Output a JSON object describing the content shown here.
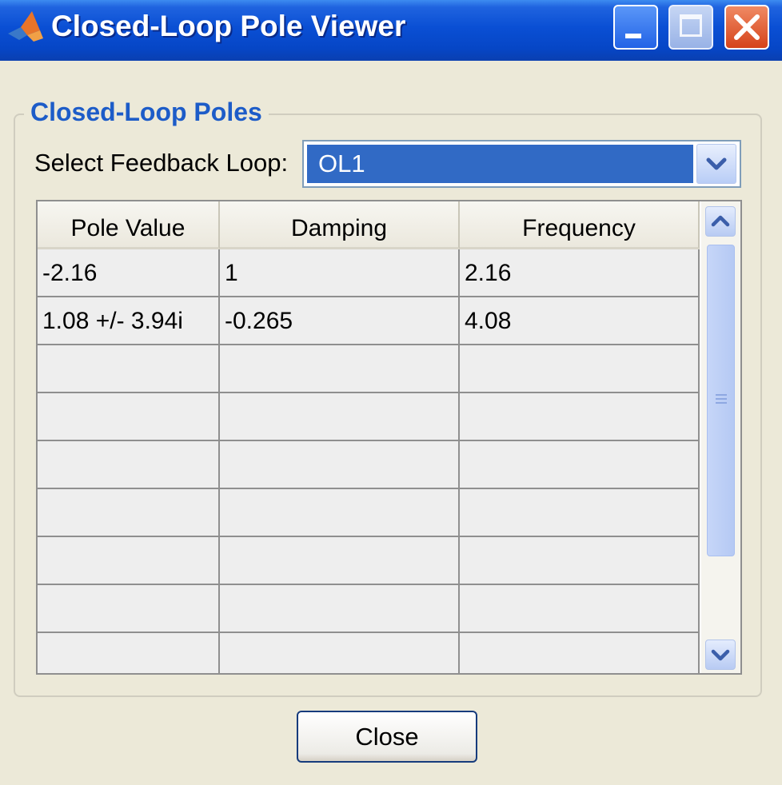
{
  "window": {
    "title": "Closed-Loop Pole Viewer",
    "icon": "matlab-logo-icon",
    "controls": [
      "minimize-icon",
      "maximize-icon",
      "close-icon"
    ]
  },
  "group": {
    "title": "Closed-Loop Poles",
    "select_label": "Select Feedback Loop:",
    "select_value": "OL1"
  },
  "table": {
    "columns": [
      "Pole Value",
      "Damping",
      "Frequency"
    ],
    "rows": [
      [
        "-2.16",
        "1",
        "2.16"
      ],
      [
        "1.08 +/- 3.94i",
        "-0.265",
        "4.08"
      ],
      [
        "",
        "",
        ""
      ],
      [
        "",
        "",
        ""
      ],
      [
        "",
        "",
        ""
      ],
      [
        "",
        "",
        ""
      ],
      [
        "",
        "",
        ""
      ],
      [
        "",
        "",
        ""
      ],
      [
        "",
        "",
        ""
      ]
    ]
  },
  "buttons": {
    "close_label": "Close"
  },
  "colors": {
    "title_bar": "#0a4fd4",
    "group_title": "#1d5cc8",
    "selection": "#316ac5",
    "window_bg": "#ece9d8"
  }
}
